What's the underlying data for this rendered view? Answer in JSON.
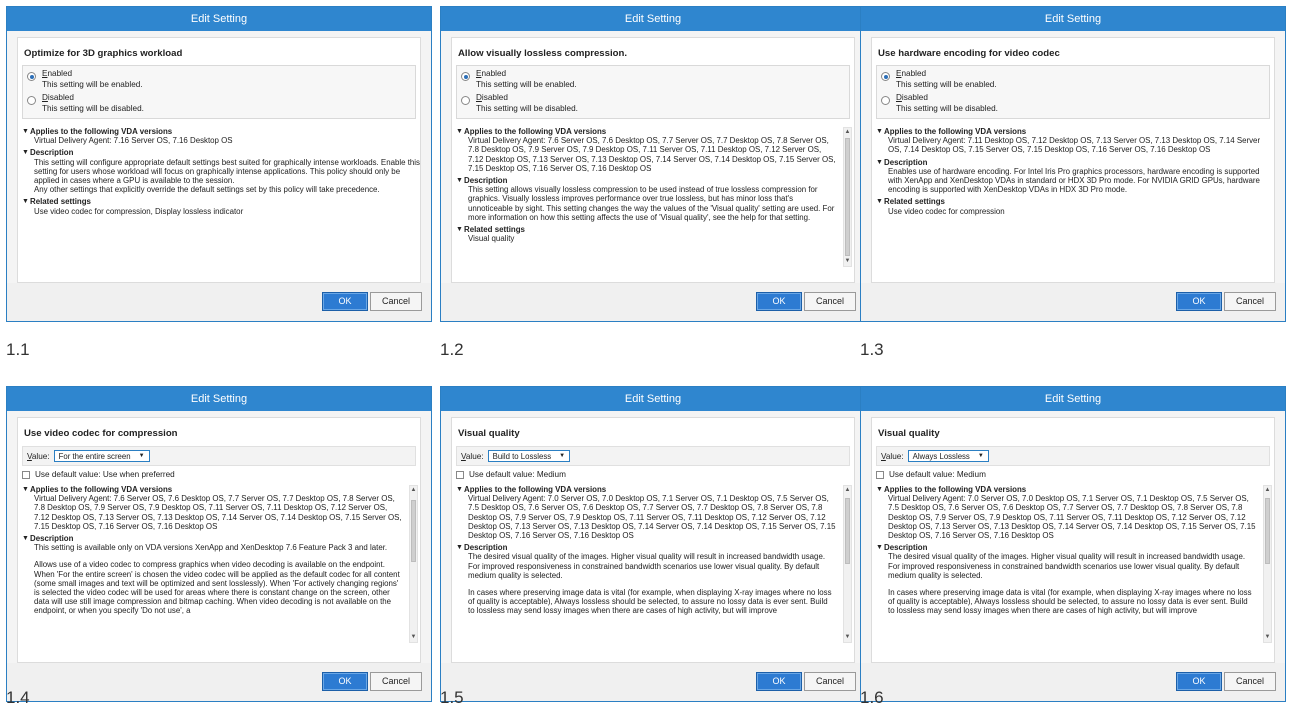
{
  "dialog_title": "Edit Setting",
  "ok_label": "OK",
  "cancel_label": "Cancel",
  "arrow_glyph": "▼",
  "radio_icon": "radio-button",
  "dialogs": [
    {
      "caption": "1.1",
      "setting_title": "Optimize for 3D graphics workload",
      "enabled_label": "Enabled",
      "enabled_desc": "This setting will be enabled.",
      "disabled_label": "Disabled",
      "disabled_desc": "This setting will be disabled.",
      "applies_heading": "Applies to the following VDA versions",
      "applies_text": "Virtual Delivery Agent: 7.16 Server OS, 7.16 Desktop OS",
      "description_heading": "Description",
      "description_text": "This setting will configure appropriate default settings best suited for graphically intense workloads. Enable this setting for users whose workload will focus on graphically intense applications. This policy should only be applied in cases where a GPU is available to the session.",
      "description_text2": "Any other settings that explicitly override the default settings set by this policy will take precedence.",
      "related_heading": "Related settings",
      "related_text": "Use video codec for compression, Display lossless indicator"
    },
    {
      "caption": "1.2",
      "setting_title": "Allow visually lossless compression.",
      "enabled_label": "Enabled",
      "enabled_desc": "This setting will be enabled.",
      "disabled_label": "Disabled",
      "disabled_desc": "This setting will be disabled.",
      "applies_heading": "Applies to the following VDA versions",
      "applies_text": "Virtual Delivery Agent: 7.6 Server OS, 7.6 Desktop OS, 7.7 Server OS, 7.7 Desktop OS, 7.8 Server OS, 7.8 Desktop OS, 7.9 Server OS, 7.9 Desktop OS, 7.11 Server OS, 7.11 Desktop OS, 7.12 Server OS, 7.12 Desktop OS, 7.13 Server OS, 7.13 Desktop OS, 7.14 Server OS, 7.14 Desktop OS, 7.15 Server OS, 7.15 Desktop OS, 7.16 Server OS, 7.16 Desktop OS",
      "description_heading": "Description",
      "description_text": "This setting allows visually lossless compression to be used instead of true lossless compression for graphics. Visually lossless improves performance over true lossless, but has minor loss that's unnoticeable by sight. This setting changes the way the values of the 'Visual quality' setting are used. For more information on how this setting affects the use of 'Visual quality', see the help for that setting.",
      "related_heading": "Related settings",
      "related_text": "Visual quality"
    },
    {
      "caption": "1.3",
      "setting_title": "Use hardware encoding for video codec",
      "enabled_label": "Enabled",
      "enabled_desc": "This setting will be enabled.",
      "disabled_label": "Disabled",
      "disabled_desc": "This setting will be disabled.",
      "applies_heading": "Applies to the following VDA versions",
      "applies_text": "Virtual Delivery Agent: 7.11 Desktop OS, 7.12 Desktop OS, 7.13 Server OS, 7.13 Desktop OS, 7.14 Server OS, 7.14 Desktop OS, 7.15 Server OS, 7.15 Desktop OS, 7.16 Server OS, 7.16 Desktop OS",
      "description_heading": "Description",
      "description_text": "Enables use of hardware encoding. For Intel Iris Pro graphics processors, hardware encoding is supported with XenApp and XenDesktop VDAs in standard or HDX 3D Pro mode. For NVIDIA GRID GPUs, hardware encoding is supported with XenDesktop VDAs in HDX 3D Pro mode.",
      "related_heading": "Related settings",
      "related_text": "Use video codec for compression"
    },
    {
      "caption": "1.4",
      "setting_title": "Use video codec for compression",
      "value_label": "Value:",
      "value_selected": "For the entire screen",
      "default_label": "Use default value: Use when preferred",
      "applies_heading": "Applies to the following VDA versions",
      "applies_text": "Virtual Delivery Agent: 7.6 Server OS, 7.6 Desktop OS, 7.7 Server OS, 7.7 Desktop OS, 7.8 Server OS, 7.8 Desktop OS, 7.9 Server OS, 7.9 Desktop OS, 7.11 Server OS, 7.11 Desktop OS, 7.12 Server OS, 7.12 Desktop OS, 7.13 Server OS, 7.13 Desktop OS, 7.14 Server OS, 7.14 Desktop OS, 7.15 Server OS, 7.15 Desktop OS, 7.16 Server OS, 7.16 Desktop OS",
      "description_heading": "Description",
      "description_text": "This setting is available only on VDA versions XenApp and XenDesktop 7.6 Feature Pack 3 and later.",
      "description_text2": "Allows use of a video codec to compress graphics when video decoding is available on the endpoint. When 'For the entire screen' is chosen the video codec will be applied as the default codec for all content (some small images and text will be optimized and sent losslessly). When 'For actively changing regions' is selected the video codec will be used for areas where there is constant change on the screen, other data will use still image compression and bitmap caching. When video decoding is not available on the endpoint, or when you specify 'Do not use', a"
    },
    {
      "caption": "1.5",
      "setting_title": "Visual quality",
      "value_label": "Value:",
      "value_selected": "Build to Lossless",
      "default_label": "Use default value: Medium",
      "applies_heading": "Applies to the following VDA versions",
      "applies_text": "Virtual Delivery Agent: 7.0 Server OS, 7.0 Desktop OS, 7.1 Server OS, 7.1 Desktop OS, 7.5 Server OS, 7.5 Desktop OS, 7.6 Server OS, 7.6 Desktop OS, 7.7 Server OS, 7.7 Desktop OS, 7.8 Server OS, 7.8 Desktop OS, 7.9 Server OS, 7.9 Desktop OS, 7.11 Server OS, 7.11 Desktop OS, 7.12 Server OS, 7.12 Desktop OS, 7.13 Server OS, 7.13 Desktop OS, 7.14 Server OS, 7.14 Desktop OS, 7.15 Server OS, 7.15 Desktop OS, 7.16 Server OS, 7.16 Desktop OS",
      "description_heading": "Description",
      "description_text": "The desired visual quality of the images. Higher visual quality will result in increased bandwidth usage. For improved responsiveness in constrained bandwidth scenarios use lower visual quality. By default medium quality is selected.",
      "description_text2": "In cases where preserving image data is vital (for example, when displaying X-ray images where no loss of quality is acceptable), Always lossless should be selected, to assure no lossy data is ever sent. Build to lossless may send lossy images when there are cases of high activity, but will improve"
    },
    {
      "caption": "1.6",
      "setting_title": "Visual quality",
      "value_label": "Value:",
      "value_selected": "Always Lossless",
      "default_label": "Use default value: Medium",
      "applies_heading": "Applies to the following VDA versions",
      "applies_text": "Virtual Delivery Agent: 7.0 Server OS, 7.0 Desktop OS, 7.1 Server OS, 7.1 Desktop OS, 7.5 Server OS, 7.5 Desktop OS, 7.6 Server OS, 7.6 Desktop OS, 7.7 Server OS, 7.7 Desktop OS, 7.8 Server OS, 7.8 Desktop OS, 7.9 Server OS, 7.9 Desktop OS, 7.11 Server OS, 7.11 Desktop OS, 7.12 Server OS, 7.12 Desktop OS, 7.13 Server OS, 7.13 Desktop OS, 7.14 Server OS, 7.14 Desktop OS, 7.15 Server OS, 7.15 Desktop OS, 7.16 Server OS, 7.16 Desktop OS",
      "description_heading": "Description",
      "description_text": "The desired visual quality of the images. Higher visual quality will result in increased bandwidth usage. For improved responsiveness in constrained bandwidth scenarios use lower visual quality. By default medium quality is selected.",
      "description_text2": "In cases where preserving image data is vital (for example, when displaying X-ray images where no loss of quality is acceptable), Always lossless should be selected, to assure no lossy data is ever sent. Build to lossless may send lossy images when there are cases of high activity, but will improve"
    }
  ]
}
